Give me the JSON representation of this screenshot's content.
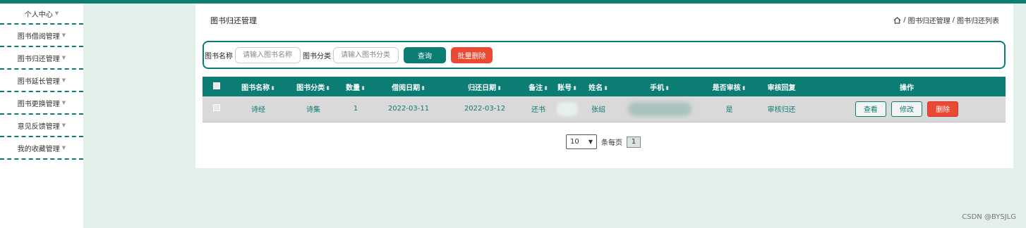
{
  "sidebar": {
    "items": [
      {
        "label": "个人中心"
      },
      {
        "label": "图书借阅管理"
      },
      {
        "label": "图书归还管理"
      },
      {
        "label": "图书延长管理"
      },
      {
        "label": "图书更换管理"
      },
      {
        "label": "意见反馈管理"
      },
      {
        "label": "我的收藏管理"
      }
    ]
  },
  "page": {
    "title": "图书归还管理",
    "breadcrumb": [
      "图书归还管理",
      "图书归还列表"
    ]
  },
  "search": {
    "name_label": "图书名称",
    "name_placeholder": "请输入图书名称",
    "category_label": "图书分类",
    "category_placeholder": "请输入图书分类",
    "query_button": "查询",
    "batch_delete_button": "批量删除"
  },
  "table": {
    "headers": [
      "图书名称",
      "图书分类",
      "数量",
      "借阅日期",
      "归还日期",
      "备注",
      "账号",
      "姓名",
      "手机",
      "是否审核",
      "审核回复",
      "操作"
    ],
    "rows": [
      {
        "book_name": "诗经",
        "category": "诗集",
        "quantity": "1",
        "borrow_date": "2022-03-11",
        "return_date": "2022-03-12",
        "remark": "还书",
        "name": "张绍",
        "approved": "是",
        "reply": "审核归还"
      }
    ],
    "actions": {
      "view": "查看",
      "edit": "修改",
      "delete": "删除"
    }
  },
  "pagination": {
    "page_size": "10",
    "per_page_label": "条每页",
    "current_page": "1"
  },
  "watermark": "CSDN @BYSJLG",
  "colors": {
    "primary": "#0b7d73",
    "danger": "#ea4a33",
    "background": "#e3efe9"
  }
}
